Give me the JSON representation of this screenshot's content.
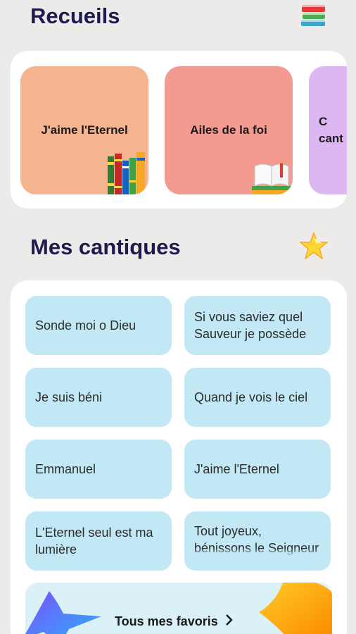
{
  "recueils": {
    "title": "Recueils",
    "icon": "books-stack-icon",
    "items": [
      {
        "label": "J'aime l'Eternel",
        "color": "#f4b48f"
      },
      {
        "label": "Ailes de la foi",
        "color": "#f49b91"
      },
      {
        "label": "C\ncant",
        "color": "#dcb7f2"
      }
    ]
  },
  "cantiques": {
    "title": "Mes cantiques",
    "icon": "star-icon",
    "items": [
      "Sonde moi o Dieu",
      "Si vous saviez quel Sauveur je possède",
      "Je suis béni",
      "Quand je vois le ciel",
      "Emmanuel",
      "J'aime l'Eternel",
      "L'Eternel seul est ma lumière",
      "Tout joyeux, bénissons le Seigneur"
    ],
    "tile_color": "#c1e8f4"
  },
  "favoris": {
    "label": "Tous mes favoris",
    "chevron": "›"
  }
}
